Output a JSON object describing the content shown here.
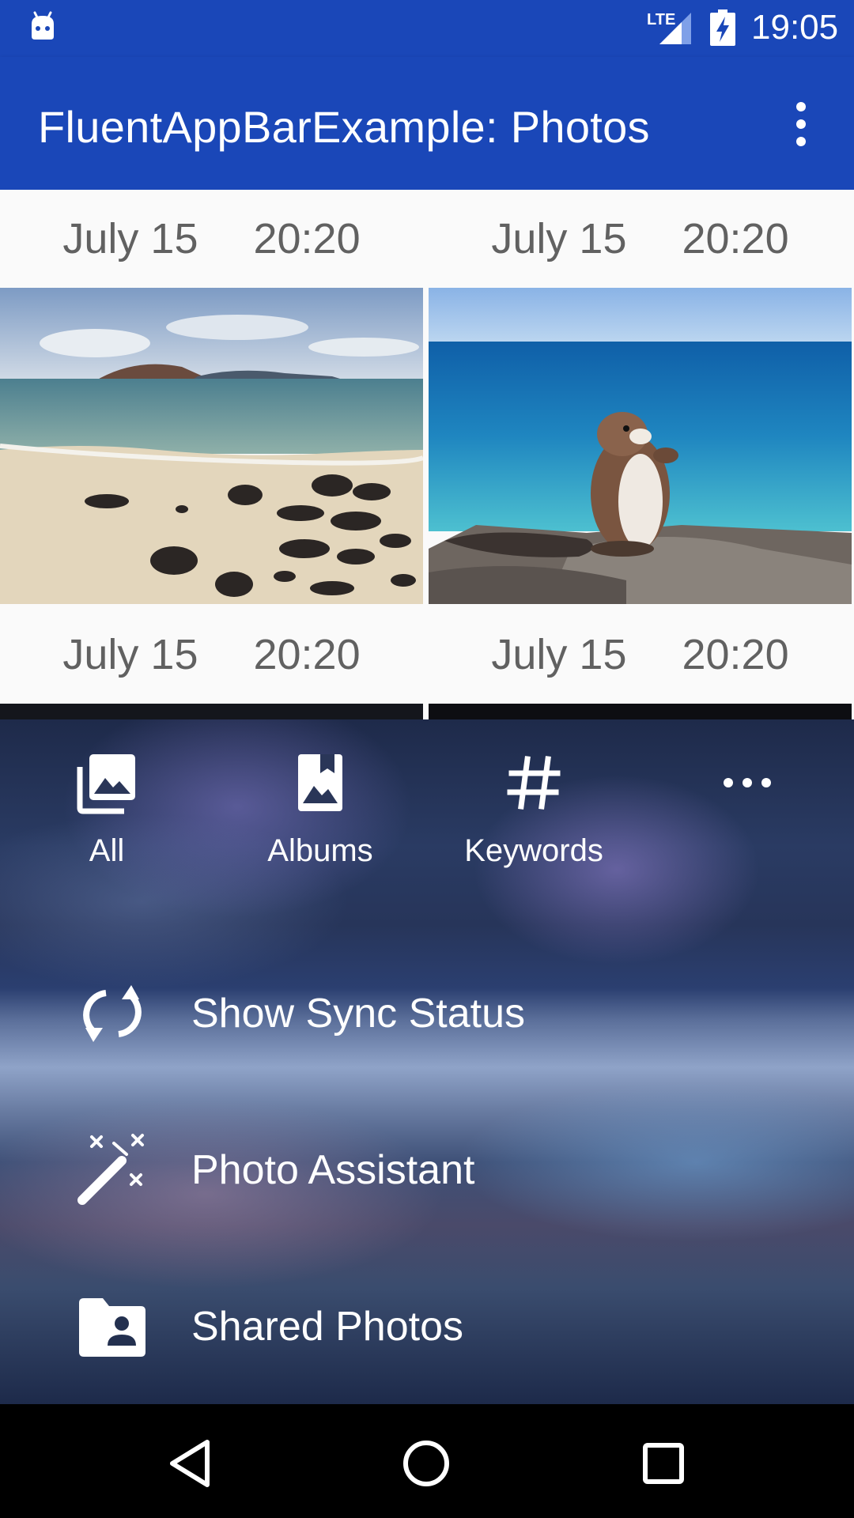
{
  "status_bar": {
    "time": "19:05",
    "network_label": "LTE",
    "icons": [
      "android-debug-icon",
      "lte-signal-icon",
      "battery-charging-icon"
    ]
  },
  "app_bar": {
    "title": "FluentAppBarExample: Photos",
    "overflow_icon": "more-vert-icon",
    "color": "#1a47b8"
  },
  "photos": [
    {
      "date": "July 15",
      "time": "20:20",
      "subject": "beach with black rocks"
    },
    {
      "date": "July 15",
      "time": "20:20",
      "subject": "squirrel on rock by sea"
    },
    {
      "date": "July 15",
      "time": "20:20",
      "subject": "dark photo"
    },
    {
      "date": "July 15",
      "time": "20:20",
      "subject": "dark photo"
    }
  ],
  "bottom_sheet": {
    "tabs": [
      {
        "label": "All",
        "icon": "photo-library-icon"
      },
      {
        "label": "Albums",
        "icon": "photo-album-icon"
      },
      {
        "label": "Keywords",
        "icon": "hashtag-icon"
      },
      {
        "label": "",
        "icon": "more-horiz-icon"
      }
    ],
    "menu_items": [
      {
        "label": "Show Sync Status",
        "icon": "sync-icon"
      },
      {
        "label": "Photo Assistant",
        "icon": "magic-wand-icon"
      },
      {
        "label": "Shared Photos",
        "icon": "shared-folder-icon"
      }
    ]
  },
  "nav_bar": {
    "buttons": [
      "back-icon",
      "home-icon",
      "recents-icon"
    ]
  }
}
